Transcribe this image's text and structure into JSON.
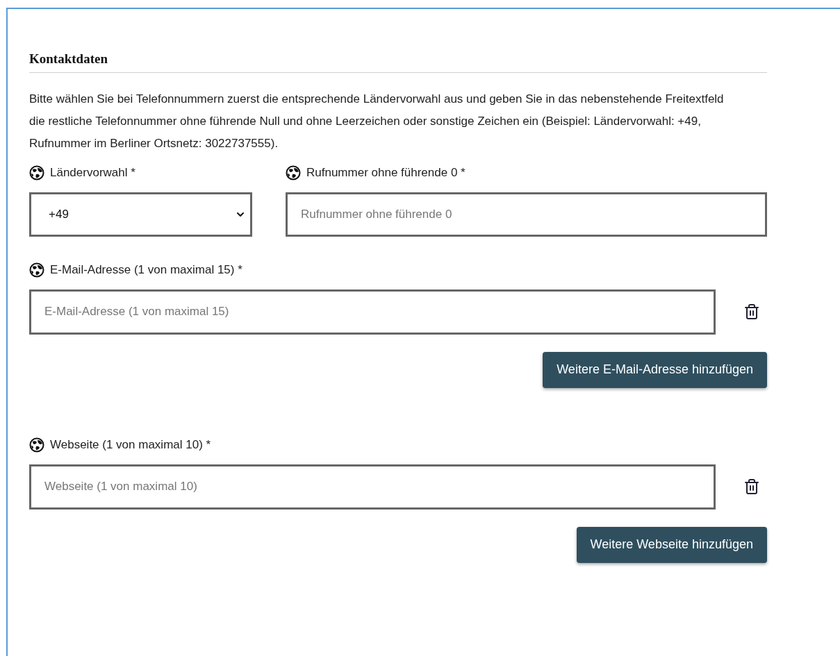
{
  "section": {
    "title": "Kontaktdaten"
  },
  "intro": "Bitte wählen Sie bei Telefonnummern zuerst die entsprechende Ländervorwahl aus und geben Sie in das nebenstehende Freitextfeld die restliche Telefonnummer ohne führende Null und ohne Leerzeichen oder sonstige Zeichen ein (Beispiel: Ländervorwahl: +49, Rufnummer im Berliner Ortsnetz: 3022737555).",
  "phone": {
    "country_code": {
      "label": "Ländervorwahl *",
      "value": "+49"
    },
    "number": {
      "label": "Rufnummer ohne führende 0 *",
      "placeholder": "Rufnummer ohne führende 0"
    }
  },
  "repeatables": [
    {
      "label": "E-Mail-Adresse (1 von maximal 15) *",
      "placeholder": "E-Mail-Adresse (1 von maximal 15)",
      "add_button": "Weitere E-Mail-Adresse hinzufügen"
    },
    {
      "label": "Webseite (1 von maximal 10) *",
      "placeholder": "Webseite (1 von maximal 10)",
      "add_button": "Weitere Webseite hinzufügen"
    }
  ]
}
